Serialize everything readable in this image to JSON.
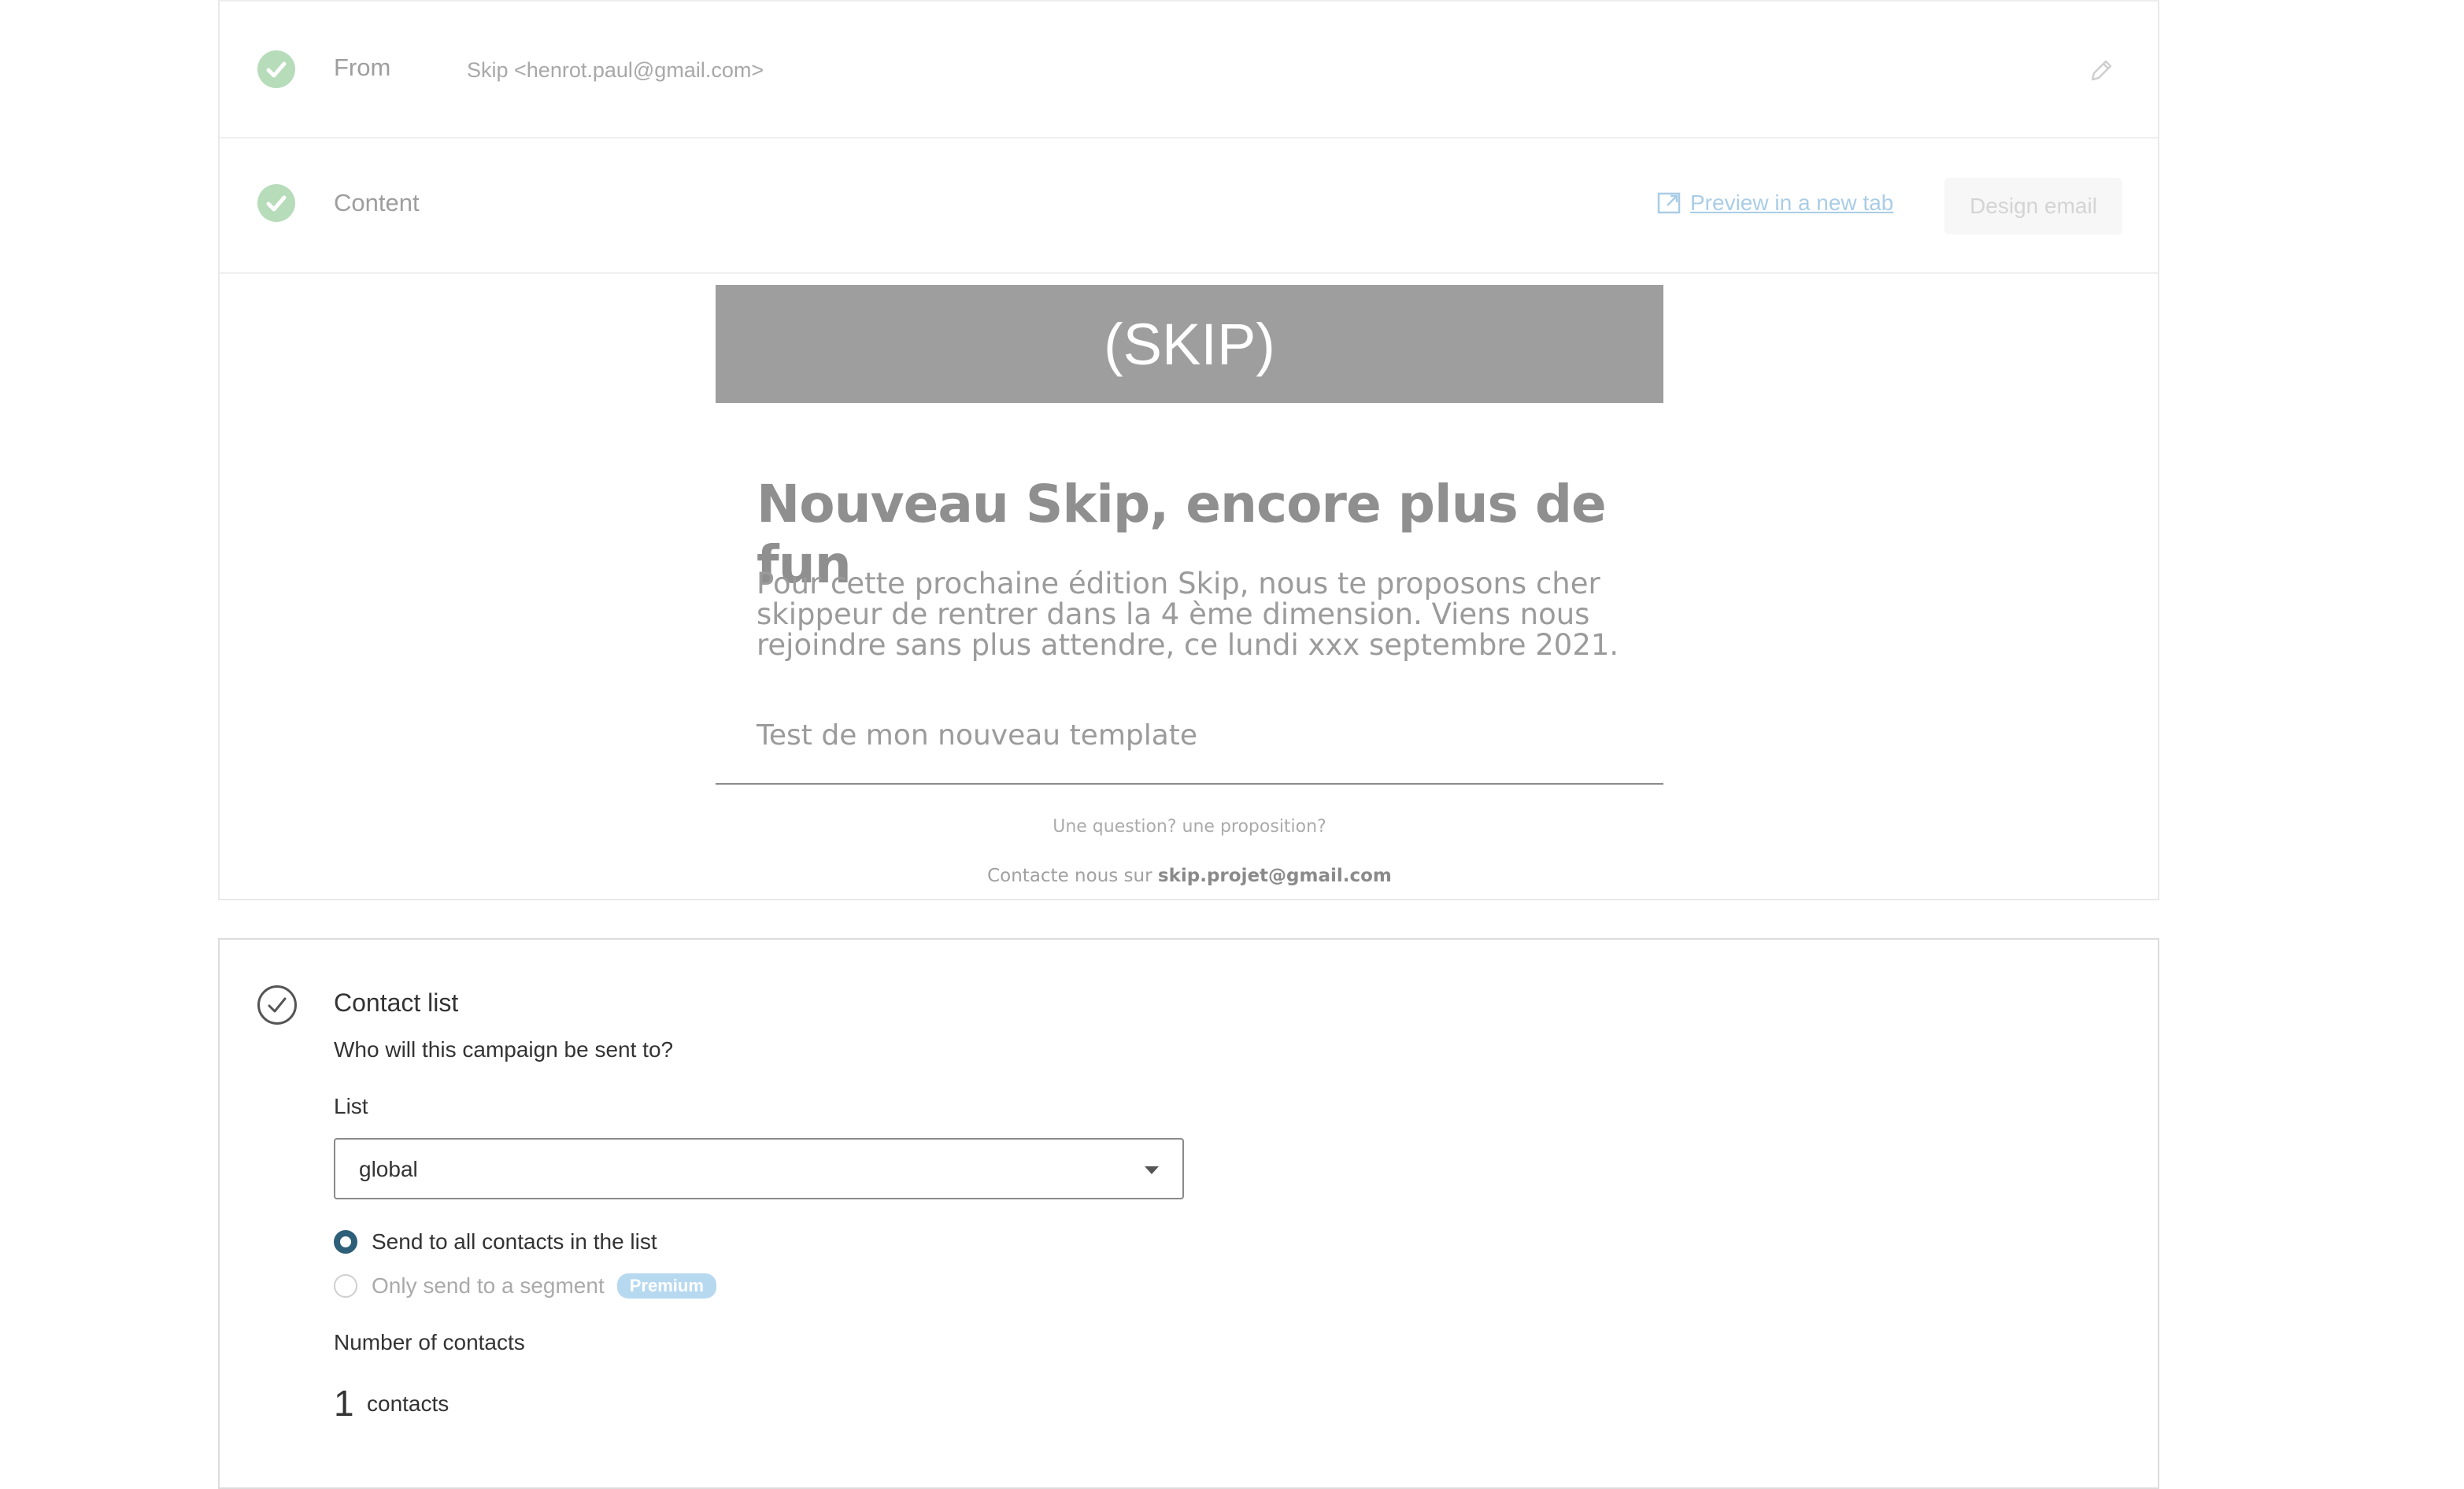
{
  "from": {
    "label": "From",
    "value": "Skip <henrot.paul@gmail.com>"
  },
  "content": {
    "label": "Content",
    "preview_link": "Preview in a new tab",
    "design_button": "Design email"
  },
  "email_preview": {
    "banner": "(SKIP)",
    "headline": "Nouveau Skip, encore plus de fun",
    "body": "Pour cette prochaine édition Skip, nous te proposons cher skippeur de rentrer dans la 4 ème dimension. Viens nous rejoindre sans plus attendre, ce lundi xxx septembre 2021.",
    "test_line": "Test de mon nouveau template",
    "question": "Une question? une proposition?",
    "contact_prefix": "Contacte nous sur",
    "contact_email": "skip.projet@gmail.com"
  },
  "contact_list": {
    "title": "Contact list",
    "subtitle": "Who will this campaign be sent to?",
    "list_label": "List",
    "selected_list": "global",
    "option_all": "Send to all contacts in the list",
    "option_segment": "Only send to a segment",
    "premium_badge": "Premium",
    "number_label": "Number of contacts",
    "count": "1",
    "count_unit": "contacts"
  },
  "colors": {
    "check_done": "#b6dcb9",
    "radio_selected": "#2e5f78",
    "premium": "#b7d9f0",
    "banner": "#9e9e9e"
  },
  "icons": {
    "from_status": "check-circle-icon",
    "content_status": "check-circle-icon",
    "edit": "pencil-icon",
    "preview": "external-preview-icon",
    "contact_status": "check-outline-circle-icon",
    "dropdown": "caret-down-icon"
  }
}
